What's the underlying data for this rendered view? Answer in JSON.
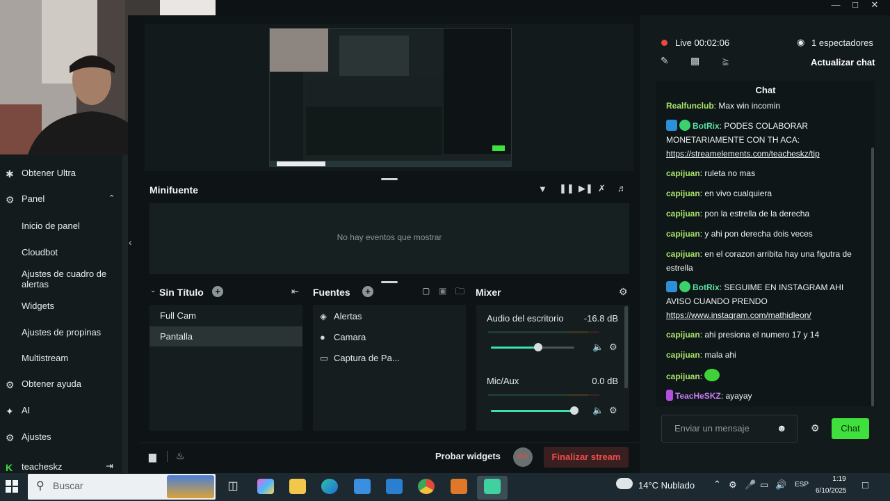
{
  "window": {
    "min_icon": "minimize-icon",
    "max_icon": "maximize-icon",
    "close_icon": "close-icon"
  },
  "sidebar": {
    "items": [
      {
        "label": "Obtener Ultra",
        "icon": "ultra-icon"
      },
      {
        "label": "Panel",
        "icon": "panel-icon"
      },
      {
        "label": "Inicio de panel"
      },
      {
        "label": "Cloudbot"
      },
      {
        "label": "Ajustes de cuadro de alertas"
      },
      {
        "label": "Widgets"
      },
      {
        "label": "Ajustes de propinas"
      },
      {
        "label": "Multistream"
      },
      {
        "label": "Obtener ayuda",
        "icon": "help-icon"
      },
      {
        "label": "AI",
        "icon": "ai-sparkle-icon"
      },
      {
        "label": "Ajustes",
        "icon": "gear-icon"
      },
      {
        "label": "teacheskz",
        "icon": "kick-logo-icon"
      }
    ]
  },
  "minifuente": {
    "title": "Minifuente",
    "empty_message": "No hay eventos que mostrar"
  },
  "scenes": {
    "title": "Sin Título",
    "items": [
      "Full Cam",
      "Pantalla"
    ],
    "selected": "Pantalla"
  },
  "sources": {
    "title": "Fuentes",
    "items": [
      {
        "label": "Alertas",
        "icon": "globe-icon"
      },
      {
        "label": "Camara",
        "icon": "camera-icon"
      },
      {
        "label": "Captura de Pa...",
        "icon": "monitor-icon"
      }
    ]
  },
  "mixer": {
    "title": "Mixer",
    "channels": [
      {
        "label": "Audio del escritorio",
        "db": "-16.8 dB",
        "level": 0.57
      },
      {
        "label": "Mic/Aux",
        "db": "0.0 dB",
        "level": 1.0
      }
    ]
  },
  "bottom": {
    "probar": "Probar widgets",
    "rec": "REC",
    "finalizar": "Finalizar stream"
  },
  "right": {
    "live": "Live 00:02:06",
    "viewers": "1 espectadores",
    "actualizar": "Actualizar chat",
    "chat_title": "Chat",
    "input_placeholder": "Enviar un mensaje",
    "send": "Chat"
  },
  "chat": [
    {
      "user": "Realfunclub",
      "text": "Max win incomin"
    },
    {
      "user": "BotRix",
      "text": "PODES COLABORAR MONETARIAMENTE CON TH ACA:",
      "link": "https://streamelements.com/teacheskz/tip"
    },
    {
      "user": "capijuan",
      "text": "ruleta no mas"
    },
    {
      "user": "capijuan",
      "text": "en vivo cualquiera"
    },
    {
      "user": "capijuan",
      "text": "pon la estrella de la derecha"
    },
    {
      "user": "capijuan",
      "text": "y ahi pon derecha dois veces"
    },
    {
      "user": "capijuan",
      "text": "en el corazon arribita hay una figutra de estrella"
    },
    {
      "user": "BotRix",
      "text": "SEGUIME EN INSTAGRAM AHI AVISO CUANDO PRENDO",
      "link": "https://www.instagram.com/mathidleon/"
    },
    {
      "user": "capijuan",
      "text": "ahi presiona el numero 17 y 14"
    },
    {
      "user": "capijuan",
      "text": "mala ahi"
    },
    {
      "user": "capijuan",
      "text": ""
    },
    {
      "user": "TeacHeSKZ",
      "text": "ayayay"
    }
  ],
  "taskbar": {
    "search_placeholder": "Buscar",
    "weather": "14°C  Nublado",
    "lang": "ESP",
    "time": "1:19",
    "date": "6/10/2025"
  }
}
